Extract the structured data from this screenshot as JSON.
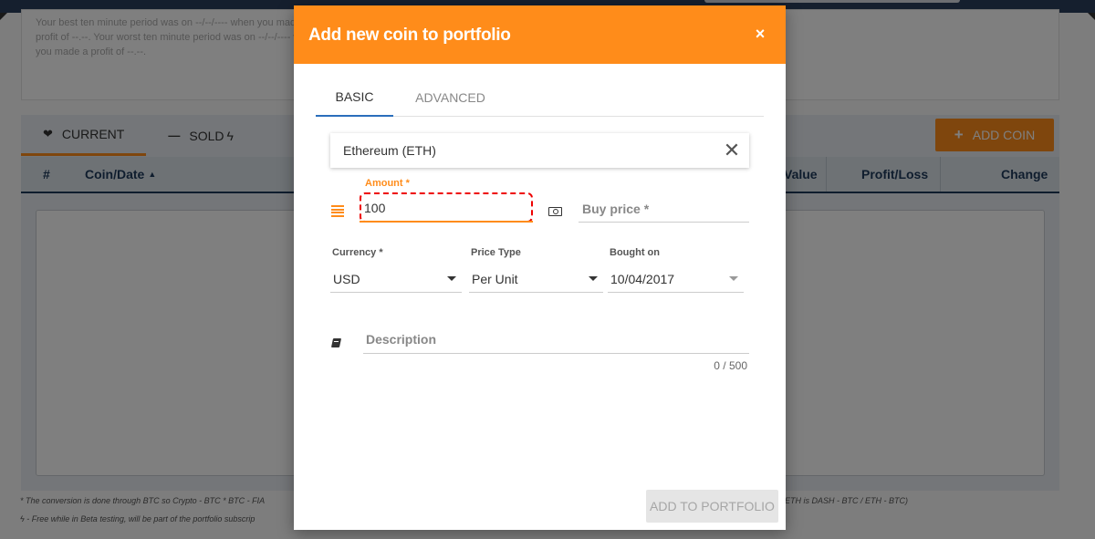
{
  "background": {
    "info_text": "Your best ten minute period was on --/--/---- when you made a profit of --.--. Your worst ten minute period was on --/--/---- when you made a profit of --.--.",
    "tabs": [
      {
        "label": "CURRENT",
        "icon": "heartbeat-icon"
      },
      {
        "label": "SOLD",
        "icon": "minus-icon"
      }
    ],
    "add_coin_label": "ADD COIN",
    "table_headers": [
      "#",
      "Coin/Date",
      "Value",
      "Profit/Loss",
      "Change"
    ],
    "footnote_left_1": "* The conversion is done through BTC so Crypto - BTC * BTC - FIA",
    "footnote_left_2": "- Free while in Beta testing, will be part of the portfolio subscrip",
    "footnote_right_1": "ETH is DASH - BTC / ETH - BTC)"
  },
  "modal": {
    "title": "Add new coin to portfolio",
    "close_symbol": "×",
    "tabs": {
      "basic": "BASIC",
      "advanced": "ADVANCED"
    },
    "coin": {
      "selected": "Ethereum (ETH)",
      "clear_symbol": "✕"
    },
    "amount": {
      "label": "Amount *",
      "value": "100"
    },
    "buy_price": {
      "placeholder": "Buy price *"
    },
    "currency": {
      "label": "Currency *",
      "value": "USD"
    },
    "price_type": {
      "label": "Price Type",
      "value": "Per Unit"
    },
    "bought_on": {
      "label": "Bought on",
      "value": "10/04/2017"
    },
    "description": {
      "placeholder": "Description",
      "counter": "0 / 500"
    },
    "submit_label": "ADD TO PORTFOLIO"
  },
  "colors": {
    "accent": "#ff8c1a",
    "navy": "#1f3b5c",
    "highlight": "#e00000"
  }
}
